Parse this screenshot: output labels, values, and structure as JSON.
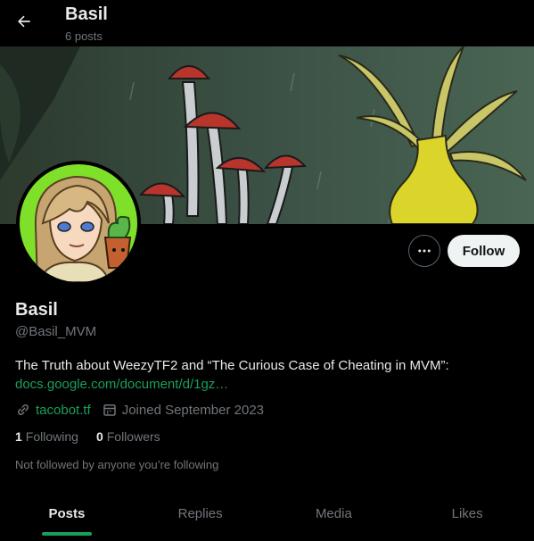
{
  "header": {
    "title": "Basil",
    "subtitle": "6 posts",
    "back_icon": "arrow-left-icon"
  },
  "profile": {
    "name": "Basil",
    "handle": "@Basil_MVM",
    "bio_text": "The Truth about WeezyTF2 and “The Curious Case of Cheating in MVM”:",
    "bio_link": "docs.google.com/document/d/1gz…",
    "website": "tacobot.tf",
    "joined": "Joined September 2023",
    "following_count": "1",
    "following_label": "Following",
    "followers_count": "0",
    "followers_label": "Followers",
    "not_followed_note": "Not followed by anyone you’re following"
  },
  "actions": {
    "more_icon": "more-horizontal-icon",
    "follow_label": "Follow"
  },
  "tabs": [
    {
      "label": "Posts",
      "active": true
    },
    {
      "label": "Replies",
      "active": false
    },
    {
      "label": "Media",
      "active": false
    },
    {
      "label": "Likes",
      "active": false
    }
  ],
  "colors": {
    "background": "#000000",
    "accent": "#1a9f5b",
    "text_primary": "#e7e9ea",
    "text_secondary": "#71767b",
    "follow_button_bg": "#eff3f4"
  }
}
